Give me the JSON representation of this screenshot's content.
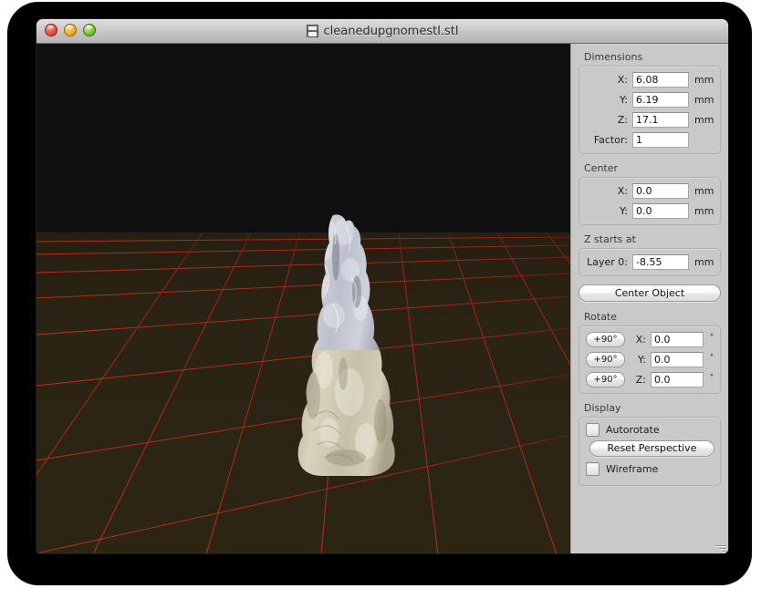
{
  "window": {
    "title": "cleanedupgnomestl.stl",
    "title_icon": "stl-document-icon",
    "close_label": "",
    "minimize_label": "",
    "zoom_label": ""
  },
  "viewport": {
    "name": "3d-model-viewport",
    "sky_color": "#101010",
    "floor_color": "#2b2414",
    "grid_color": "#aa2211",
    "model_upper_color": "#c8cad4",
    "model_lower_color": "#cfc8b0",
    "model_name": "gnome-stl-model"
  },
  "panel": {
    "dimensions": {
      "title": "Dimensions",
      "rows": [
        {
          "label": "X:",
          "value": "6.08",
          "unit": "mm"
        },
        {
          "label": "Y:",
          "value": "6.19",
          "unit": "mm"
        },
        {
          "label": "Z:",
          "value": "17.1",
          "unit": "mm"
        },
        {
          "label": "Factor:",
          "value": "1",
          "unit": ""
        }
      ]
    },
    "center": {
      "title": "Center",
      "rows": [
        {
          "label": "X:",
          "value": "0.0",
          "unit": "mm"
        },
        {
          "label": "Y:",
          "value": "0.0",
          "unit": "mm"
        }
      ]
    },
    "z_starts_at": {
      "title": "Z starts at",
      "rows": [
        {
          "label": "Layer 0:",
          "value": "-8.55",
          "unit": "mm"
        }
      ]
    },
    "center_object_button": "Center Object",
    "rotate": {
      "title": "Rotate",
      "rows": [
        {
          "button": "+90°",
          "label": "X:",
          "value": "0.0",
          "unit": "°"
        },
        {
          "button": "+90°",
          "label": "Y:",
          "value": "0.0",
          "unit": "°"
        },
        {
          "button": "+90°",
          "label": "Z:",
          "value": "0.0",
          "unit": "°"
        }
      ]
    },
    "display": {
      "title": "Display",
      "autorotate_label": "Autorotate",
      "autorotate_checked": false,
      "reset_perspective_button": "Reset Perspective",
      "wireframe_label": "Wireframe",
      "wireframe_checked": false
    }
  }
}
